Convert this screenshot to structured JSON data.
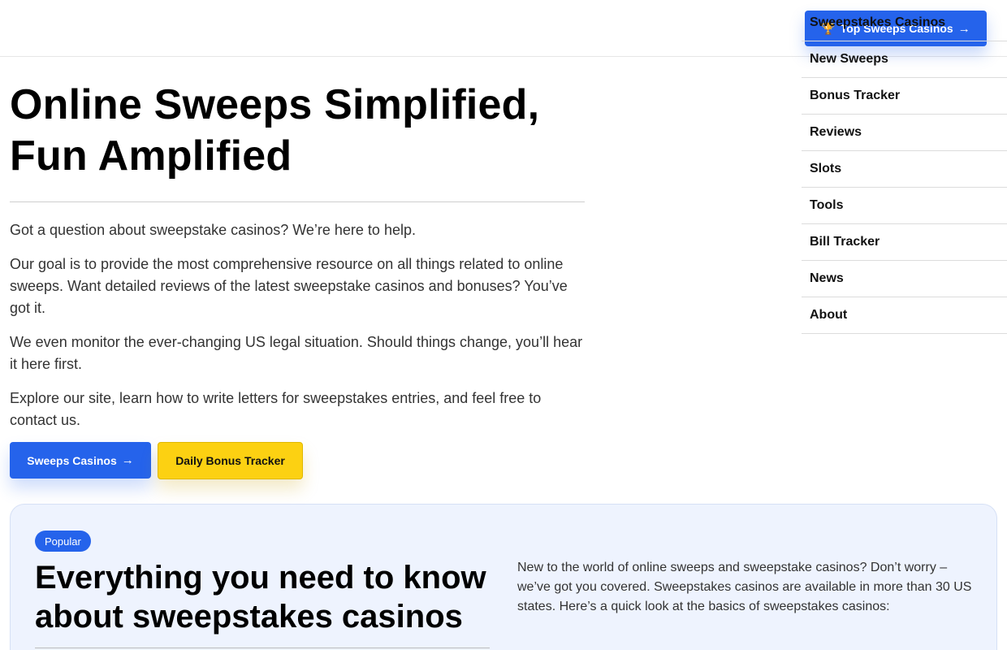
{
  "header": {
    "cta_label": "Top Sweeps Casinos",
    "cta_icon": "trophy-icon",
    "arrow_icon": "arrow-right-icon"
  },
  "nav": {
    "items": [
      {
        "label": "Sweepstakes Casinos"
      },
      {
        "label": "New Sweeps"
      },
      {
        "label": "Bonus Tracker"
      },
      {
        "label": "Reviews"
      },
      {
        "label": "Slots"
      },
      {
        "label": "Tools"
      },
      {
        "label": "Bill Tracker"
      },
      {
        "label": "News"
      },
      {
        "label": "About"
      }
    ]
  },
  "hero": {
    "title_line1": "Online Sweeps Simplified,",
    "title_line2": "Fun Amplified",
    "paragraphs": [
      "Got a question about sweepstake casinos? We’re here to help.",
      "Our goal is to provide the most comprehensive resource on all things related to online sweeps. Want detailed reviews of the latest sweepstake casinos and bonuses? You’ve got it.",
      "We even monitor the ever-changing US legal situation. Should things change, you’ll hear it here first.",
      "Explore our site, learn how to write letters for sweepstakes entries, and feel free to contact us."
    ],
    "primary_button": "Sweeps Casinos",
    "secondary_button": "Daily Bonus Tracker"
  },
  "card": {
    "badge": "Popular",
    "title": "Everything you need to know about sweepstakes casinos",
    "text": "New to the world of online sweeps and sweepstake casinos? Don’t worry – we’ve got you covered. Sweepstakes casinos are available in more than 30 US states. Here’s a quick look at the basics of sweepstakes casinos:"
  },
  "colors": {
    "primary": "#2563eb",
    "secondary": "#fcd112",
    "card_bg": "#eef3fe"
  }
}
